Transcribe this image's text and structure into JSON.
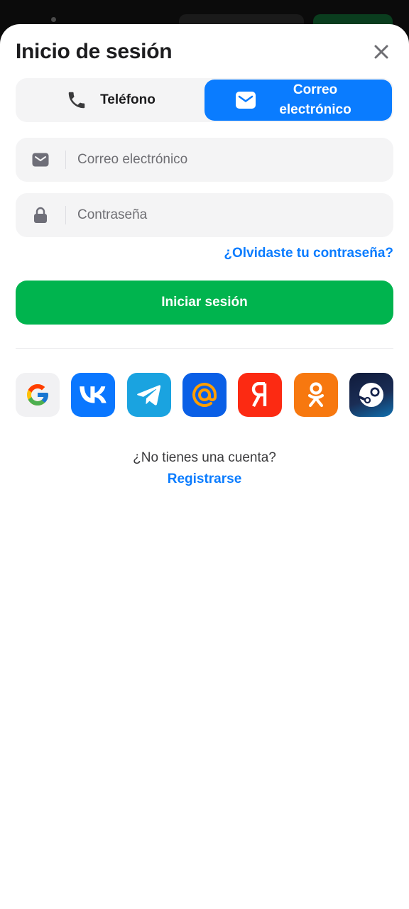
{
  "title": "Inicio de sesión",
  "tabs": [
    {
      "label": "Teléfono",
      "icon": "phone-icon",
      "active": false
    },
    {
      "label": "Correo electrónico",
      "icon": "envelope-icon",
      "active": true
    }
  ],
  "email_field": {
    "placeholder": "Correo electrónico",
    "value": "",
    "icon": "envelope-icon"
  },
  "password_field": {
    "placeholder": "Contraseña",
    "value": "",
    "icon": "lock-icon"
  },
  "forgot_password": "¿Olvidaste tu contraseña?",
  "login_button": "Iniciar sesión",
  "social_providers": [
    {
      "name": "google",
      "icon": "google-icon",
      "color": "#f1f1f3"
    },
    {
      "name": "vk",
      "icon": "vk-icon",
      "color": "#0a77ff"
    },
    {
      "name": "telegram",
      "icon": "telegram-icon",
      "color": "#1aa3e0"
    },
    {
      "name": "mail",
      "icon": "at-icon",
      "color": "#0a5fe6"
    },
    {
      "name": "yandex",
      "icon": "yandex-icon",
      "color": "#fc2a12"
    },
    {
      "name": "ok",
      "icon": "odnoklassniki-icon",
      "color": "#f7780f"
    },
    {
      "name": "steam",
      "icon": "steam-icon",
      "color": "#101b3b"
    }
  ],
  "footer": {
    "question": "¿No tienes una cuenta?",
    "register": "Registrarse"
  },
  "colors": {
    "accent": "#0a7cff",
    "primary_button": "#00b44e",
    "field_bg": "#f4f4f5"
  }
}
